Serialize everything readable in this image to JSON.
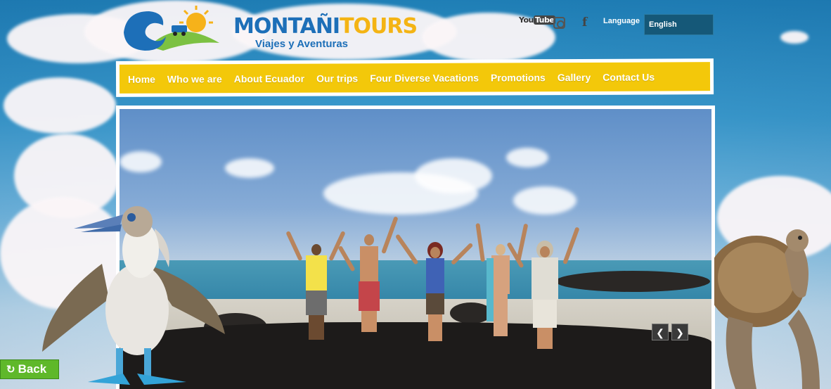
{
  "header": {
    "brand_part1": "MONTAÑI",
    "brand_part2": "TOURS",
    "tagline": "Viajes y Aventuras",
    "social": {
      "youtube_label": "You",
      "youtube_badge": "Tube",
      "facebook_glyph": "f"
    },
    "language_label": "Language",
    "language_value": "English"
  },
  "nav": {
    "items": [
      {
        "label": "Home"
      },
      {
        "label": "Who we are"
      },
      {
        "label": "About Ecuador"
      },
      {
        "label": "Our trips"
      },
      {
        "label": "Four Diverse Vacations"
      },
      {
        "label": "Promotions"
      },
      {
        "label": "Gallery"
      },
      {
        "label": "Contact Us"
      }
    ]
  },
  "slider": {
    "prev_glyph": "❮",
    "next_glyph": "❯"
  },
  "back_button": {
    "label": "Back",
    "icon": "refresh-icon"
  },
  "colors": {
    "nav_bg": "#f3c80a",
    "brand_blue": "#1d6fb8",
    "brand_yellow": "#f4b414",
    "language_bg": "#155878",
    "back_green": "#5fb82a"
  }
}
